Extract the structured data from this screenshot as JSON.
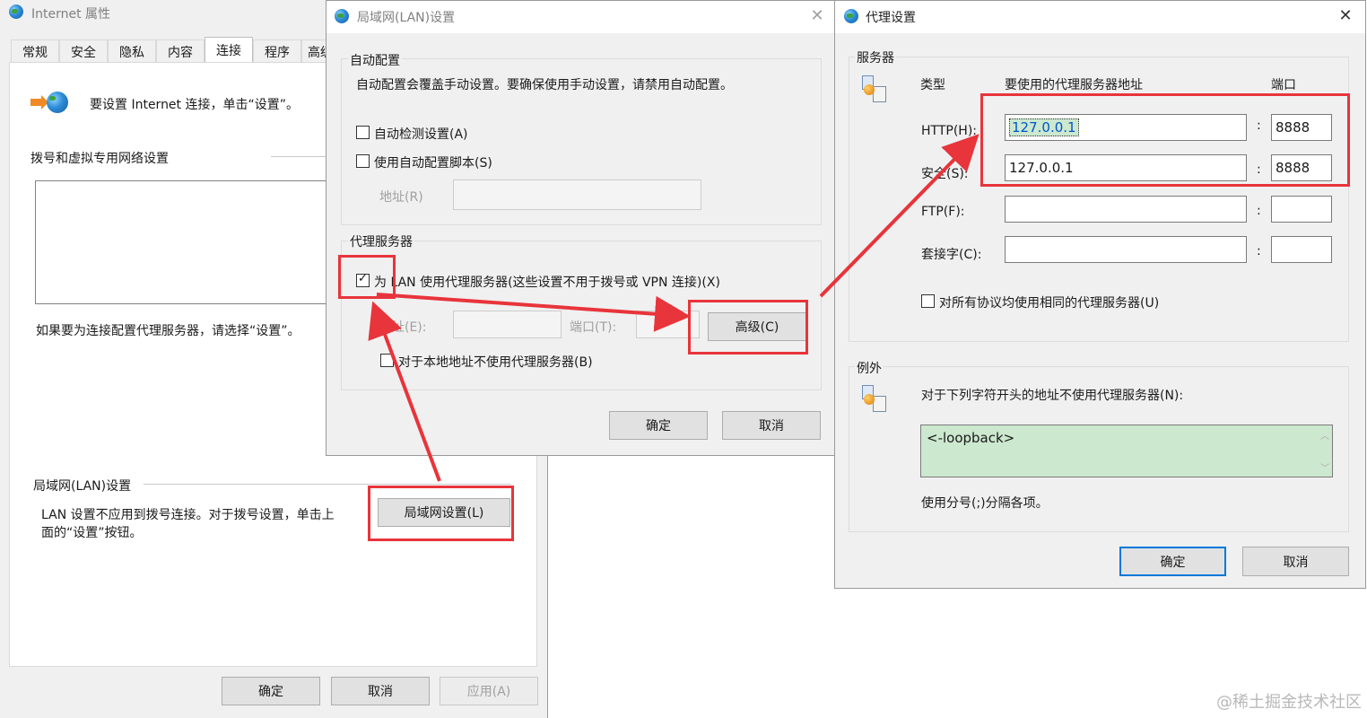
{
  "internet_props": {
    "title": "Internet 属性",
    "tabs": [
      "常规",
      "安全",
      "隐私",
      "内容",
      "连接",
      "程序",
      "高级"
    ],
    "setup_text": "要设置 Internet 连接，单击“设置”。",
    "dialup_heading": "拨号和虚拟专用网络设置",
    "proxy_hint": "如果要为连接配置代理服务器，请选择“设置”。",
    "lan_heading": "局域网(LAN)设置",
    "lan_desc_line1": "LAN 设置不应用到拨号连接。对于拨号设置，单击上",
    "lan_desc_line2": "面的“设置”按钮。",
    "lan_settings_button": "局域网设置(L)",
    "ok": "确定",
    "cancel": "取消",
    "apply": "应用(A)"
  },
  "lan_dialog": {
    "title": "局域网(LAN)设置",
    "auto_config_heading": "自动配置",
    "auto_config_desc": "自动配置会覆盖手动设置。要确保使用手动设置，请禁用自动配置。",
    "auto_detect_label": "自动检测设置(A)",
    "auto_detect_checked": false,
    "use_script_label": "使用自动配置脚本(S)",
    "use_script_checked": false,
    "address_label": "地址(R)",
    "proxy_heading": "代理服务器",
    "use_proxy_label": "为 LAN 使用代理服务器(这些设置不用于拨号或 VPN 连接)(X)",
    "use_proxy_checked": true,
    "proxy_address_label": "地址(E):",
    "proxy_port_label": "端口(T):",
    "advanced_button": "高级(C)",
    "bypass_local_label": "对于本地地址不使用代理服务器(B)",
    "bypass_local_checked": false,
    "ok": "确定",
    "cancel": "取消"
  },
  "proxy_settings": {
    "title": "代理设置",
    "servers_heading": "服务器",
    "col_type": "类型",
    "col_address": "要使用的代理服务器地址",
    "col_port": "端口",
    "rows": [
      {
        "label": "HTTP(H):",
        "address": "127.0.0.1",
        "port": "8888"
      },
      {
        "label": "安全(S):",
        "address": "127.0.0.1",
        "port": "8888"
      },
      {
        "label": "FTP(F):",
        "address": "",
        "port": ""
      },
      {
        "label": "套接字(C):",
        "address": "",
        "port": ""
      }
    ],
    "colon": ":",
    "same_proxy_label": "对所有协议均使用相同的代理服务器(U)",
    "same_proxy_checked": false,
    "exceptions_heading": "例外",
    "exceptions_desc": "对于下列字符开头的地址不使用代理服务器(N):",
    "exceptions_value": "<-loopback>",
    "exceptions_hint": "使用分号(;)分隔各项。",
    "ok": "确定",
    "cancel": "取消"
  },
  "annotation": {
    "color": "#e8343b"
  },
  "watermark": "@稀土掘金技术社区"
}
